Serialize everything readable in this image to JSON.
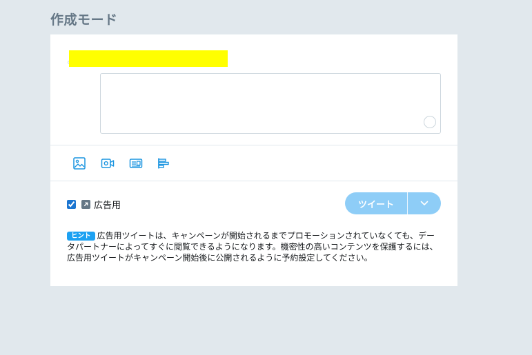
{
  "page": {
    "title": "作成モード"
  },
  "composer": {
    "value": "",
    "placeholder": ""
  },
  "media_toolbar": {
    "items": [
      {
        "icon": "image-icon"
      },
      {
        "icon": "video-icon"
      },
      {
        "icon": "card-icon"
      },
      {
        "icon": "poll-icon"
      }
    ]
  },
  "promotion": {
    "checked": true,
    "icon": "promoted-arrow-icon",
    "label": "広告用"
  },
  "actions": {
    "tweet_label": "ツイート",
    "dropdown_icon": "chevron-down-icon"
  },
  "hint": {
    "badge": "ヒント",
    "text": "広告用ツイートは、キャンペーンが開始されるまでプロモーションされていなくても、データパートナーによってすぐに閲覧できるようになります。機密性の高いコンテンツを保護するには、広告用ツイートがキャンペーン開始後に公開されるように予約設定してください。"
  },
  "colors": {
    "background": "#e1e8ed",
    "accent": "#1da1f2",
    "icon_blue": "#1b95e0",
    "tweet_button_disabled": "#8ecdf7",
    "redaction": "#ffff00"
  }
}
